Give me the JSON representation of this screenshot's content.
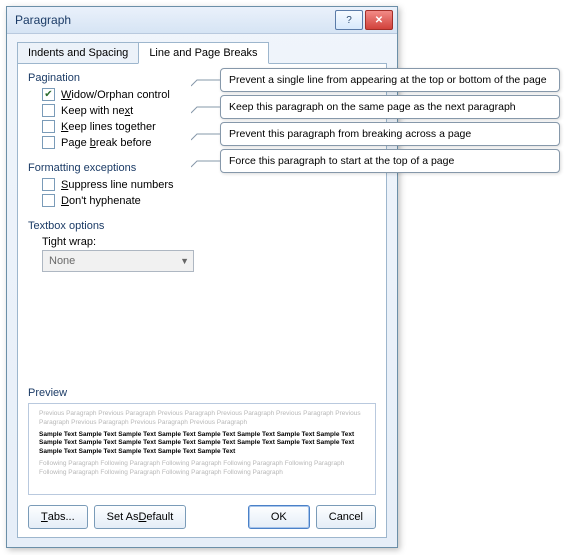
{
  "title": "Paragraph",
  "tabs": {
    "indents": "Indents and Spacing",
    "breaks": "Line and Page Breaks"
  },
  "groups": {
    "pagination": {
      "title": "Pagination",
      "widow": "Widow/Orphan control",
      "keepNext": "Keep with next",
      "keepTogether": "Keep lines together",
      "pageBreak": "Page break before"
    },
    "formatting": {
      "title": "Formatting exceptions",
      "suppress": "Suppress line numbers",
      "hyphenate": "Don't hyphenate"
    },
    "textbox": {
      "title": "Textbox options",
      "tightWrap": "Tight wrap:",
      "value": "None"
    }
  },
  "preview": {
    "title": "Preview",
    "prev": "Previous Paragraph Previous Paragraph Previous Paragraph Previous Paragraph Previous Paragraph Previous Paragraph Previous Paragraph Previous Paragraph Previous Paragraph",
    "sample": "Sample Text Sample Text Sample Text Sample Text Sample Text Sample Text Sample Text Sample Text Sample Text Sample Text Sample Text Sample Text Sample Text Sample Text Sample Text Sample Text Sample Text Sample Text Sample Text Sample Text Sample Text",
    "next": "Following Paragraph Following Paragraph Following Paragraph Following Paragraph Following Paragraph Following Paragraph Following Paragraph Following Paragraph Following Paragraph"
  },
  "buttons": {
    "tabs": "Tabs...",
    "setDefault": "Set As Default",
    "ok": "OK",
    "cancel": "Cancel"
  },
  "callouts": {
    "widow": "Prevent a single line from appearing at the top or bottom of the page",
    "keepNext": "Keep this paragraph on the same page as the next paragraph",
    "keepTogether": "Prevent this paragraph from breaking across a page",
    "pageBreak": "Force this paragraph to start at the top of a page"
  }
}
